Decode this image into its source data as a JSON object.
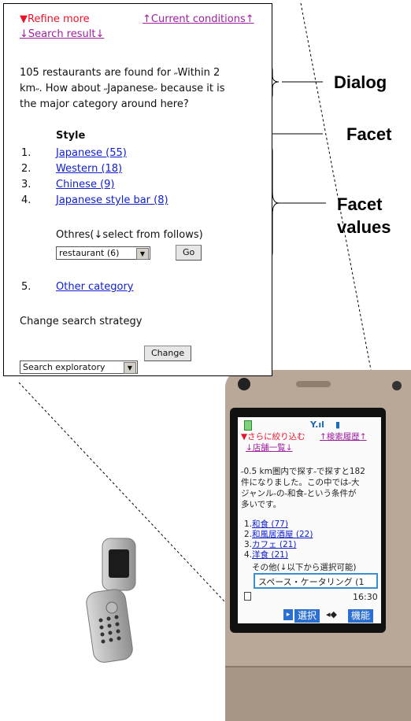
{
  "panel": {
    "nav_refine": "▼Refine more",
    "nav_conditions": "↑Current conditions↑",
    "nav_result": "↓Search result↓",
    "dialog_lines": [
      "105 restaurants are found for ˶Within 2",
      "km˶. How about ˶Japanese˶ because it is",
      "the major category around here?"
    ],
    "facet_title": "Style",
    "facet_items": [
      {
        "num": "1.",
        "label": "Japanese (55)"
      },
      {
        "num": "2.",
        "label": "Western (18)"
      },
      {
        "num": "3.",
        "label": "Chinese (9)"
      },
      {
        "num": "4.",
        "label": "Japanese style bar (8)"
      }
    ],
    "others_label": "Othres(↓select from follows)",
    "others_select": "restaurant (6)",
    "go_label": "Go",
    "other_num": "5.",
    "other_category": "Other category",
    "strategy_label": "Change search strategy",
    "strategy_select": "Search exploratory",
    "change_label": "Change"
  },
  "callouts": {
    "dialog": "Dialog",
    "facet": "Facet",
    "facet_values_1": "Facet",
    "facet_values_2": "values"
  },
  "phone": {
    "nav_refine": "▼さらに絞り込む",
    "nav_history": "↑検索履歴↑",
    "nav_list": "↓店舗一覧↓",
    "dialog_lines": [
      "˶0.5 km圏内で探す˶で探すと182",
      "件になりました。この中では˶大",
      "ジャンル˶の˶和食˶という条件が",
      "多いです。"
    ],
    "items": [
      {
        "num": "1.",
        "label": "和食 (77)"
      },
      {
        "num": "2.",
        "label": "和風居酒屋 (22)"
      },
      {
        "num": "3.",
        "label": "カフェ (21)"
      },
      {
        "num": "4.",
        "label": "洋食 (21)"
      }
    ],
    "others_label": "その他(↓以下から選択可能)",
    "select_value": "スペース・ケータリング (1",
    "time": "16:30",
    "softkey_select": "選択",
    "softkey_function": "機能"
  }
}
